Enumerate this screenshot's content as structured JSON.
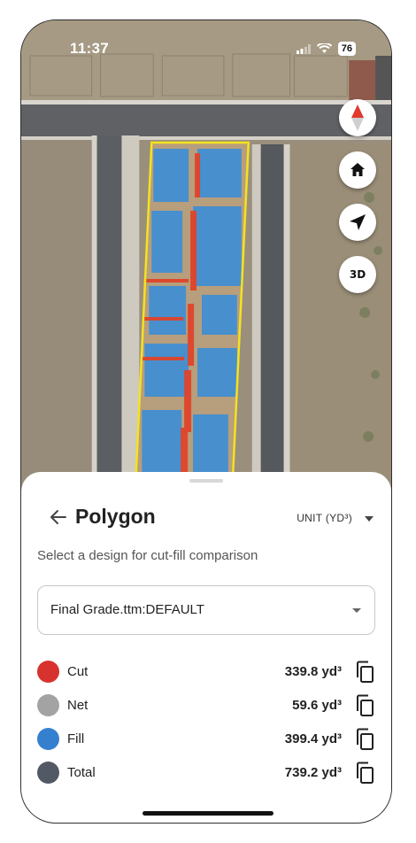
{
  "status_bar": {
    "time": "11:37",
    "battery": "76"
  },
  "map_controls": [
    {
      "name": "compass-button",
      "icon": "compass-icon"
    },
    {
      "name": "home-button",
      "icon": "home-icon"
    },
    {
      "name": "locate-button",
      "icon": "navigation-arrow-icon"
    },
    {
      "name": "toggle-3d-button",
      "label": "3D"
    }
  ],
  "panel": {
    "title": "Polygon",
    "unit_selector": "UNIT (YD³)",
    "subtitle": "Select a design for cut-fill comparison",
    "design_select": {
      "value": "Final Grade.ttm:DEFAULT"
    },
    "metrics": [
      {
        "label": "Cut",
        "value": "339.8 yd³",
        "color": "#d7322d"
      },
      {
        "label": "Net",
        "value": "59.6 yd³",
        "color": "#a3a3a3"
      },
      {
        "label": "Fill",
        "value": "399.4 yd³",
        "color": "#3480cf"
      },
      {
        "label": "Total",
        "value": "739.2 yd³",
        "color": "#535865"
      }
    ]
  },
  "colors": {
    "polygon_outline": "#f4e31e",
    "cut": "#e0442a",
    "fill": "#3f8ed4"
  }
}
